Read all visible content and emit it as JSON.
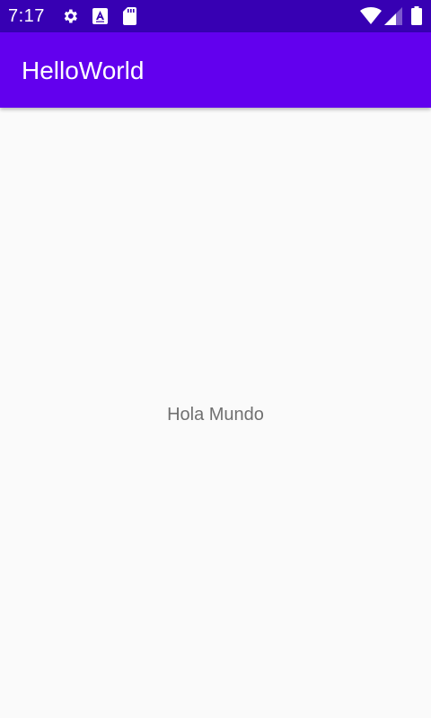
{
  "status_bar": {
    "time": "7:17",
    "left_icons": [
      "gear-icon",
      "accessibility-a-icon",
      "sd-card-icon"
    ],
    "right_icons": [
      "wifi-icon",
      "cellular-signal-icon",
      "battery-icon"
    ],
    "background_color": "#3700b3"
  },
  "app_bar": {
    "title": "HelloWorld",
    "background_color": "#6200ee"
  },
  "main": {
    "text": "Hola Mundo",
    "text_color": "#707070",
    "background_color": "#fafafa"
  }
}
